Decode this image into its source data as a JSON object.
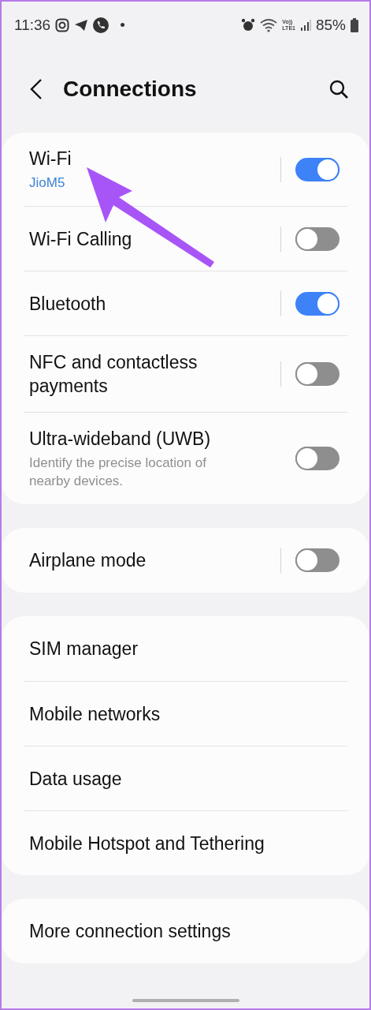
{
  "status_bar": {
    "time": "11:36",
    "dot": "•",
    "network_label": [
      "Vo))",
      "LTE1"
    ],
    "battery": "85%"
  },
  "header": {
    "title": "Connections"
  },
  "groups": [
    {
      "rows": [
        {
          "kind": "toggle",
          "title": "Wi-Fi",
          "subtitle": {
            "kind": "status",
            "text": "JioM5"
          },
          "split": true,
          "on": true
        },
        {
          "kind": "toggle",
          "title": "Wi-Fi Calling",
          "split": true,
          "on": false
        },
        {
          "kind": "toggle",
          "title": "Bluetooth",
          "split": true,
          "on": true
        },
        {
          "kind": "toggle",
          "title": "NFC and contactless payments",
          "split": true,
          "on": false
        },
        {
          "kind": "toggle",
          "title": "Ultra-wideband (UWB)",
          "subtitle": {
            "kind": "description",
            "text": "Identify the precise location of nearby devices."
          },
          "split": false,
          "on": false
        }
      ]
    },
    {
      "rows": [
        {
          "kind": "toggle",
          "title": "Airplane mode",
          "split": true,
          "on": false
        }
      ]
    },
    {
      "rows": [
        {
          "kind": "link",
          "title": "SIM manager"
        },
        {
          "kind": "link",
          "title": "Mobile networks"
        },
        {
          "kind": "link",
          "title": "Data usage"
        },
        {
          "kind": "link",
          "title": "Mobile Hotspot and Tethering"
        }
      ]
    },
    {
      "rows": [
        {
          "kind": "link",
          "title": "More connection settings"
        }
      ]
    }
  ]
}
